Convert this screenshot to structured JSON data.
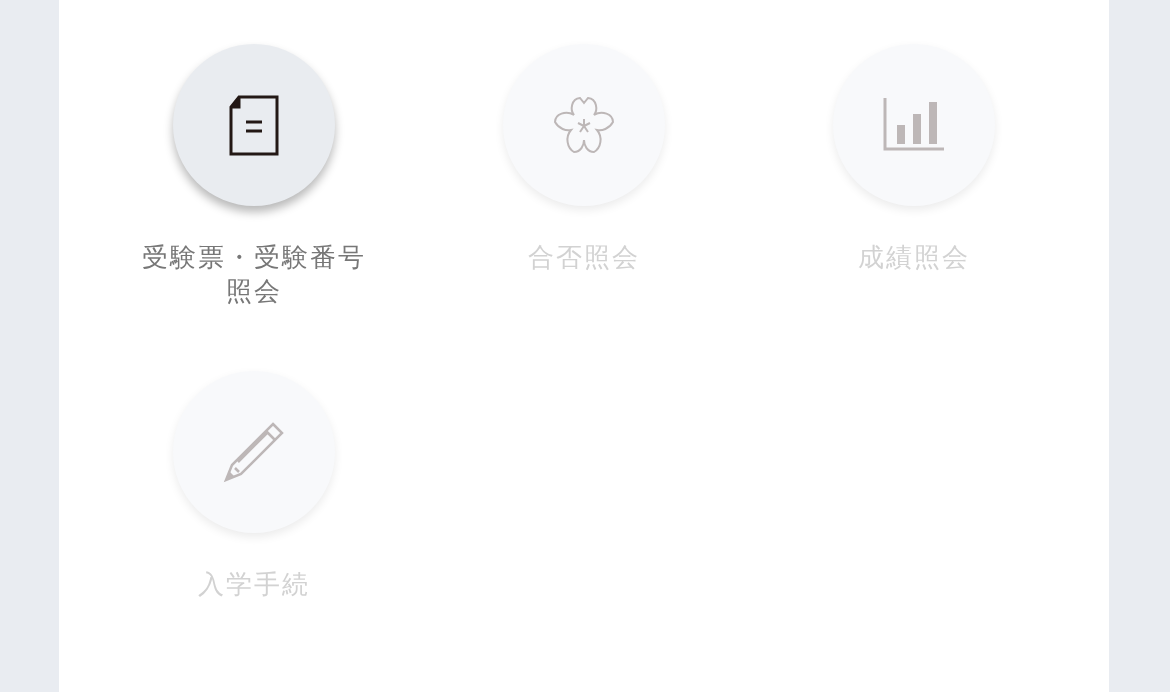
{
  "menu": [
    {
      "label": "受験票・受験番号照会",
      "disabled": false
    },
    {
      "label": "合否照会",
      "disabled": true
    },
    {
      "label": "成績照会",
      "disabled": true
    },
    {
      "label": "入学手続",
      "disabled": true
    }
  ]
}
